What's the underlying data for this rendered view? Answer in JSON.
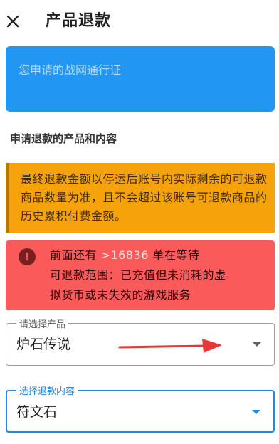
{
  "header": {
    "title": "产品退款",
    "close_icon": "close-icon"
  },
  "account_input": {
    "placeholder": "您申请的战网通行证"
  },
  "section": {
    "title": "申请退款的产品和内容"
  },
  "notice_orange": {
    "text": "最终退款金额以停运后账号内实际剩余的可退款商品数量为准，且不会超过该账号可退款商品的历史累积付费金额。",
    "color": "#f5a20b"
  },
  "notice_red": {
    "line1_prefix": "前面还有 ",
    "queue_count": ">16836",
    "line1_suffix": " 单在等待",
    "line2": "可退款范围：已充值但未消耗的虚",
    "line3": "拟货币或未失效的游戏服务",
    "icon": "info-icon",
    "color": "#fb5a5a"
  },
  "product_select": {
    "label": "请选择产品",
    "value": "炉石传说"
  },
  "content_select": {
    "label": "选择退款内容",
    "value": "符文石"
  },
  "colors": {
    "accent": "#2196f3",
    "focus": "#1e88e5",
    "annotation_arrow": "#e53935"
  }
}
